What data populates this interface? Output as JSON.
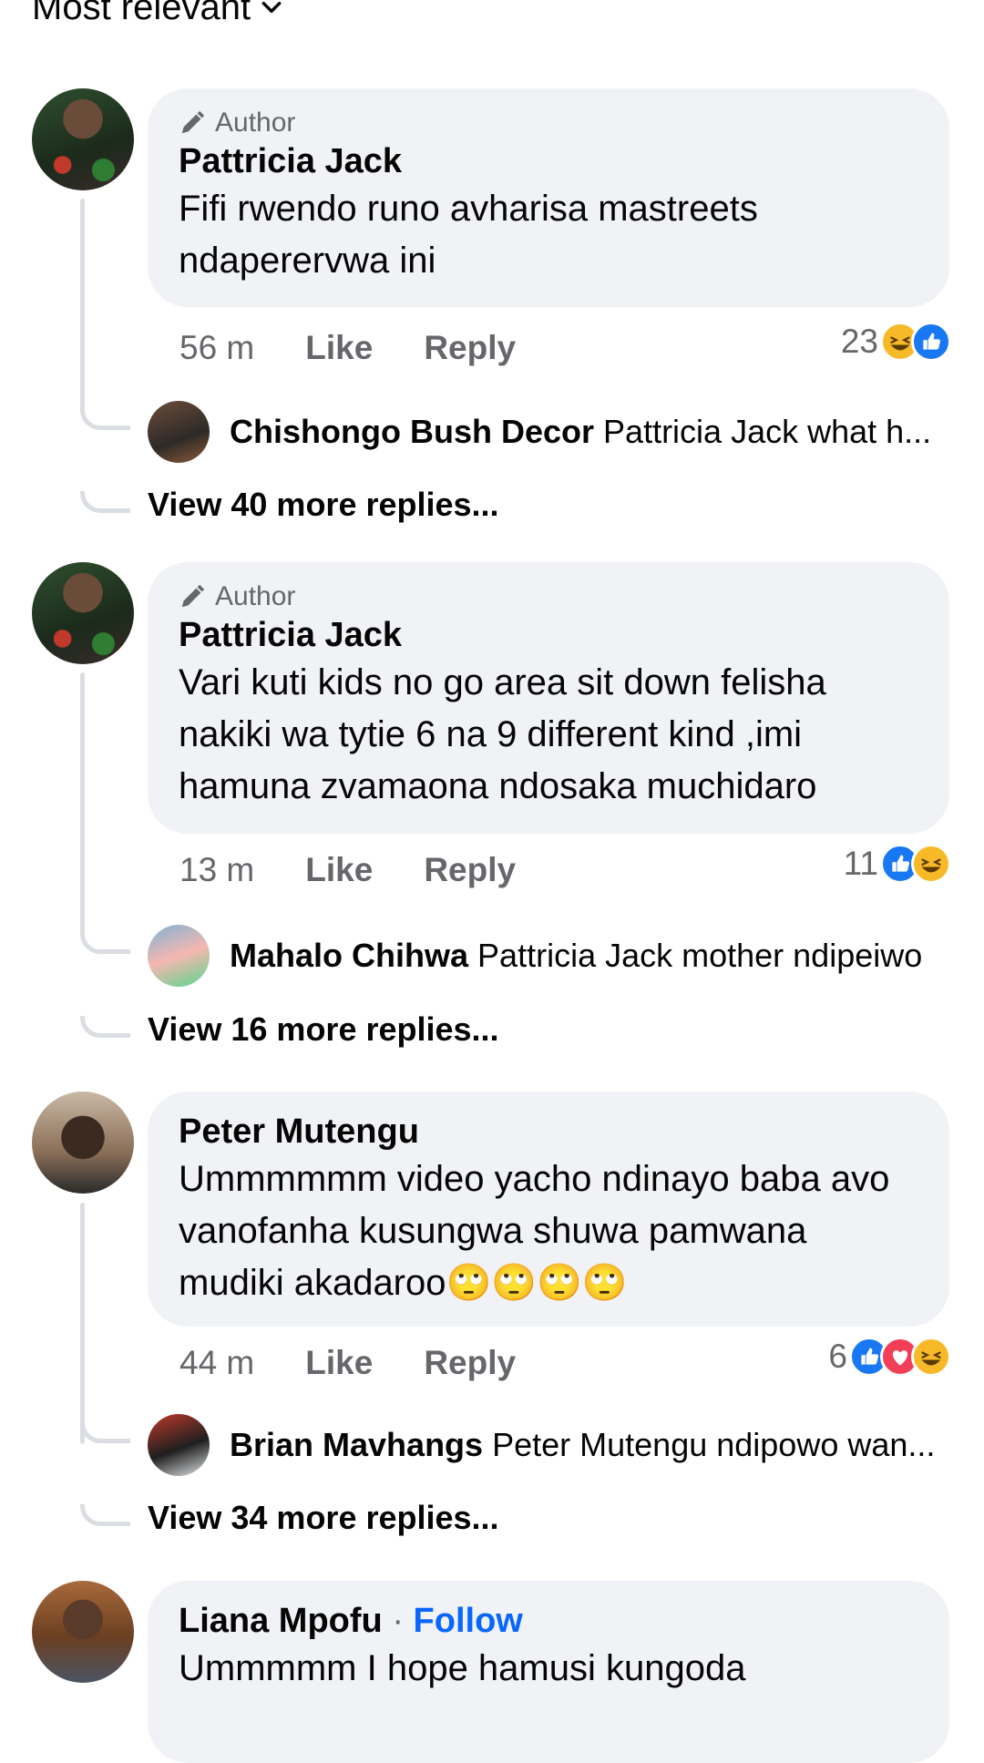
{
  "sort": {
    "label": "Most relevant"
  },
  "colors": {
    "like": "#1877f2",
    "haha": "#f7b928",
    "love": "#f33e58",
    "bubble": "#f0f2f5",
    "link": "#0866ff"
  },
  "comments": [
    {
      "badge": "Author",
      "name": "Pattricia Jack",
      "text": "Fifi rwendo runo avharisa mastreets ndaperervwa ini",
      "time": "56 m",
      "like": "Like",
      "reply": "Reply",
      "reaction_count": "23",
      "reactions": [
        "haha",
        "like"
      ],
      "top_reply": {
        "name": "Chishongo Bush Decor",
        "text": "Pattricia Jack what h..."
      },
      "view_more": "View 40 more replies..."
    },
    {
      "badge": "Author",
      "name": "Pattricia Jack",
      "text": "Vari kuti kids no go area sit down felisha nakiki wa tytie 6 na 9 different kind ,imi hamuna zvamaona ndosaka muchidaro",
      "time": "13 m",
      "like": "Like",
      "reply": "Reply",
      "reaction_count": "11",
      "reactions": [
        "like",
        "haha"
      ],
      "top_reply": {
        "name": "Mahalo Chihwa",
        "text": "Pattricia Jack mother ndipeiwo"
      },
      "view_more": "View 16 more replies..."
    },
    {
      "name": "Peter Mutengu",
      "text": "Ummmmmm video yacho ndinayo baba avo vanofanha kusungwa shuwa pamwana mudiki akadaroo🙄🙄🙄🙄",
      "time": "44 m",
      "like": "Like",
      "reply": "Reply",
      "reaction_count": "6",
      "reactions": [
        "like",
        "love",
        "haha"
      ],
      "top_reply": {
        "name": "Brian Mavhangs",
        "text": "Peter Mutengu ndipowo wan..."
      },
      "view_more": "View 34 more replies..."
    },
    {
      "name": "Liana Mpofu",
      "follow": "Follow",
      "text": "Ummmmm I hope hamusi kungoda"
    }
  ]
}
